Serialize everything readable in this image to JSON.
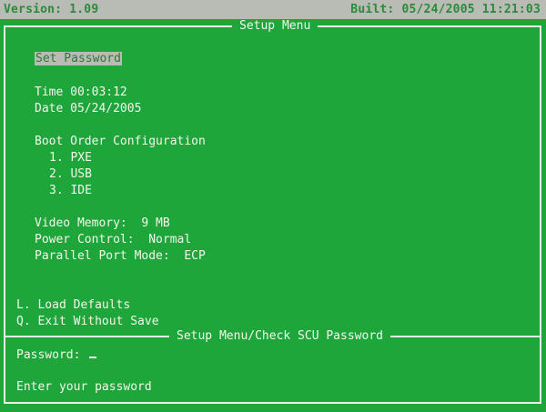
{
  "header": {
    "version": "Version: 1.09",
    "built": "Built: 05/24/2005 11:21:03"
  },
  "setup_menu": {
    "title": "Setup Menu",
    "set_password": "Set Password",
    "time": "Time 00:03:12",
    "date": "Date 05/24/2005",
    "boot_order_heading": "Boot Order Configuration",
    "boot_order": [
      "1. PXE",
      "2. USB",
      "3. IDE"
    ],
    "video_memory": "Video Memory:  9 MB",
    "power_control": "Power Control:  Normal",
    "parallel_port_mode": "Parallel Port Mode:  ECP",
    "load_defaults": "L. Load Defaults",
    "exit_without_save": "Q. Exit Without Save"
  },
  "password_dialog": {
    "title": "Setup Menu/Check SCU Password",
    "label": "Password:",
    "value": "",
    "prompt": "Enter your password"
  },
  "colors": {
    "background": "#1fa63a",
    "text": "#f2f6ee",
    "highlight": "#b9bcb4"
  }
}
